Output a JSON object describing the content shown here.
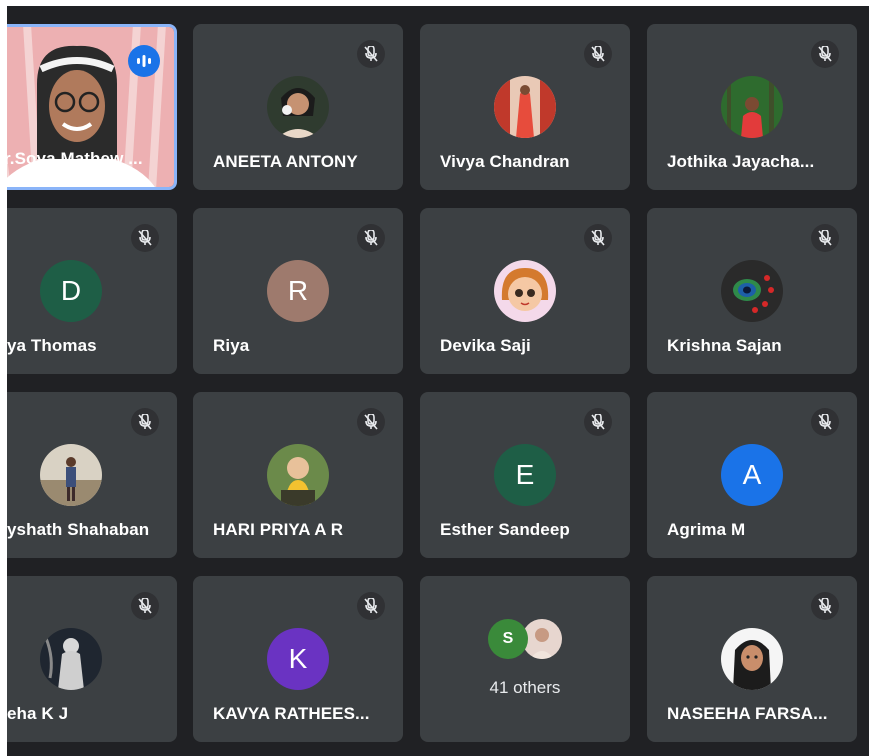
{
  "tiles": [
    {
      "name": "r.Soya Mathew ...",
      "type": "video",
      "speaking": true
    },
    {
      "name": "ANEETA ANTONY",
      "type": "photo",
      "photo": "person-photo",
      "muted": true
    },
    {
      "name": "Vivya Chandran",
      "type": "photo",
      "photo": "person-photo",
      "muted": true
    },
    {
      "name": "Jothika Jayacha...",
      "type": "photo",
      "photo": "person-photo",
      "muted": true
    },
    {
      "name": "ya Thomas",
      "type": "letter",
      "letter": "D",
      "color": "#1e5e46",
      "muted": true
    },
    {
      "name": "Riya",
      "type": "letter",
      "letter": "R",
      "color": "#9e7a6d",
      "muted": true
    },
    {
      "name": "Devika Saji",
      "type": "photo",
      "photo": "cartoon-avatar",
      "muted": true
    },
    {
      "name": "Krishna Sajan",
      "type": "photo",
      "photo": "peacock-feather-image",
      "muted": true
    },
    {
      "name": "yshath Shahaban",
      "type": "photo",
      "photo": "person-photo",
      "muted": true
    },
    {
      "name": "HARI PRIYA A R",
      "type": "photo",
      "photo": "child-photo",
      "muted": true
    },
    {
      "name": "Esther Sandeep",
      "type": "letter",
      "letter": "E",
      "color": "#1e5e46",
      "muted": true
    },
    {
      "name": "Agrima M",
      "type": "letter",
      "letter": "A",
      "color": "#1a73e8",
      "muted": true
    },
    {
      "name": "eha K J",
      "type": "photo",
      "photo": "statue-photo",
      "muted": true
    },
    {
      "name": "KAVYA RATHEES...",
      "type": "letter",
      "letter": "K",
      "color": "#6a33c2",
      "muted": true
    },
    {
      "name": "",
      "type": "others",
      "others_label": "41 others",
      "mini_letter": "S",
      "mini_color": "#3a8a3a"
    },
    {
      "name": "NASEEHA FARSA...",
      "type": "photo",
      "photo": "person-photo",
      "muted": true
    }
  ],
  "icons": {
    "mute": "mic-off-icon",
    "speaking": "audio-level-icon"
  }
}
